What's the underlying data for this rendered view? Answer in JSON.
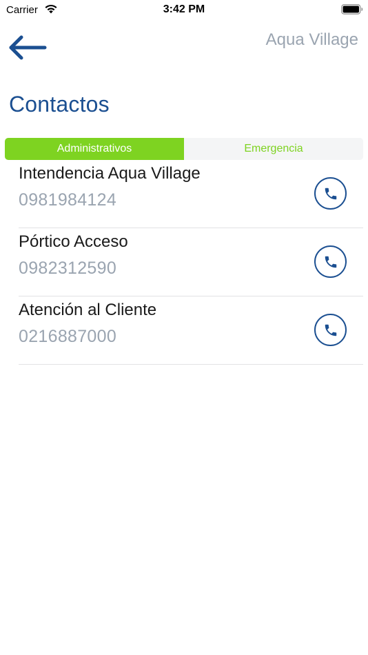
{
  "status_bar": {
    "carrier": "Carrier",
    "time": "3:42 PM"
  },
  "nav": {
    "title": "Aqua Village"
  },
  "page": {
    "title": "Contactos"
  },
  "tabs": [
    {
      "label": "Administrativos",
      "selected": true
    },
    {
      "label": "Emergencia",
      "selected": false
    }
  ],
  "contacts": [
    {
      "name": "Intendencia Aqua Village",
      "phone": "0981984124"
    },
    {
      "name": "Pórtico Acceso",
      "phone": "0982312590"
    },
    {
      "name": "Atención al Cliente",
      "phone": "0216887000"
    }
  ],
  "colors": {
    "accent_green": "#7ed321",
    "brand_blue": "#1b4f91",
    "muted_gray": "#9aa4b0"
  },
  "icons": {
    "back": "arrow-left-icon",
    "call": "phone-icon",
    "wifi": "wifi-icon",
    "battery": "battery-icon"
  }
}
